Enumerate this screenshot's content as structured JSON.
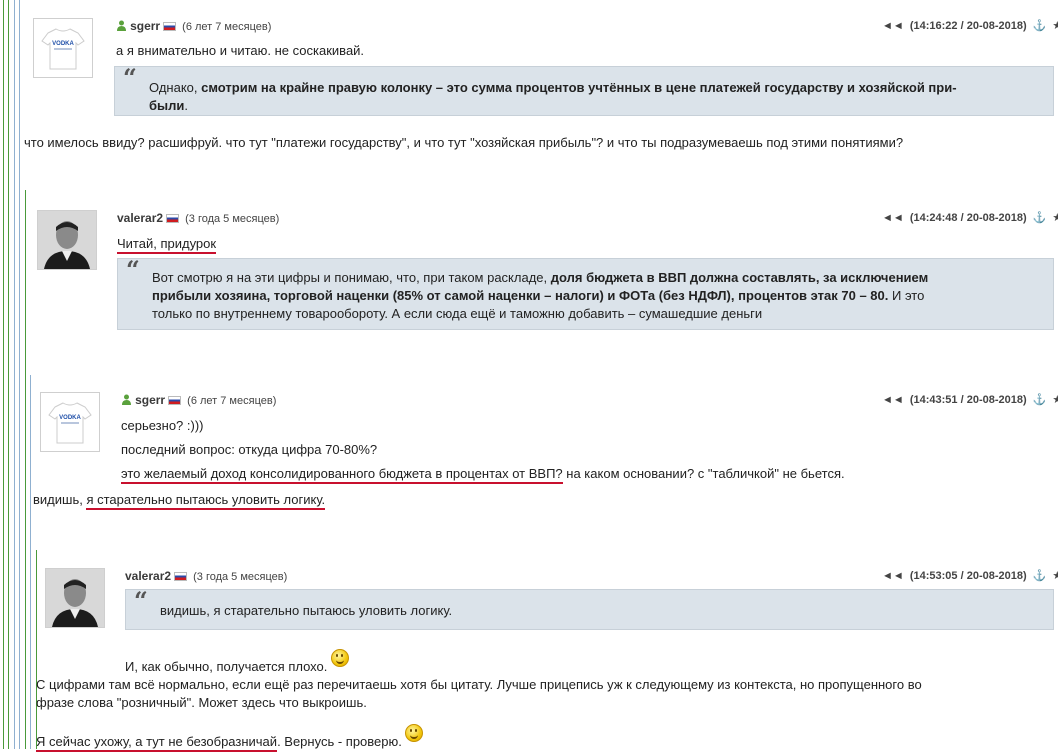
{
  "posts": [
    {
      "user": "sgerr",
      "tenure": "(6 лет 7 месяцев)",
      "time": "(14:16:22 / 20-08-2018)",
      "avatar_text": "VODKA",
      "lines": [
        "а я внимательно и читаю. не соскакивай."
      ],
      "quote": {
        "pre": "Однако, ",
        "bold": "смотрим на крайне правую колонку – это сумма процентов учтённых в цене платежей государству и хозяйской при-",
        "bold2": "были",
        "post": "."
      },
      "after": "что имелось ввиду? расшифруй. что тут \"платежи государству\", и что тут \"хозяйская прибыль\"? и что ты подразумеваешь под этими понятиями?"
    },
    {
      "user": "valerar2",
      "tenure": "(3 года 5 месяцев)",
      "time": "(14:24:48 / 20-08-2018)",
      "lines": [
        "Читай, придурок"
      ],
      "quote": {
        "l1a": "Вот смотрю я на эти цифры и понимаю, что, при таком раскладе, ",
        "l1b": "доля бюджета в ВВП должна составлять, за исключением",
        "l2a": "прибыли хозяина, торговой наценки (85% от самой наценки – налоги) и ФОТа (без НДФЛ), процентов этак 70 – 80.",
        "l2b": " И это",
        "l3": "только по внутреннему товарообороту. А если сюда ещё и таможню добавить – сумашедшие деньги"
      }
    },
    {
      "user": "sgerr",
      "tenure": "(6 лет 7 месяцев)",
      "time": "(14:43:51 / 20-08-2018)",
      "avatar_text": "VODKA",
      "lines": [
        "серьезно? :)))",
        "последний вопрос: откуда цифра 70-80%?"
      ],
      "line3a": "это желаемый доход консолидированного бюджета в процентах от ВВП?",
      "line3b": " на каком основании? с \"табличкой\" не бьется.",
      "after_a": "видишь, ",
      "after_b": "я старательно пытаюсь уловить логику."
    },
    {
      "user": "valerar2",
      "tenure": "(3 года 5 месяцев)",
      "time": "(14:53:05 / 20-08-2018)",
      "quote": "видишь, я старательно пытаюсь уловить логику.",
      "line1": "И, как обычно, получается плохо.",
      "para1": "С цифрами там всё нормально, если ещё раз перечитаешь хотя бы цитату. Лучше прицепись уж к следующему из контекста, но пропущенного во",
      "para2": "фразе слова \"розничный\". Может здесь что выкроишь.",
      "last_a": "Я сейчас ухожу, а тут не безобразничай",
      "last_b": ". Вернусь - проверю."
    }
  ],
  "colors": {
    "quote_bg": "#dbe3ea",
    "underline": "#c8102e",
    "thread_line": "#4a9a3a"
  }
}
